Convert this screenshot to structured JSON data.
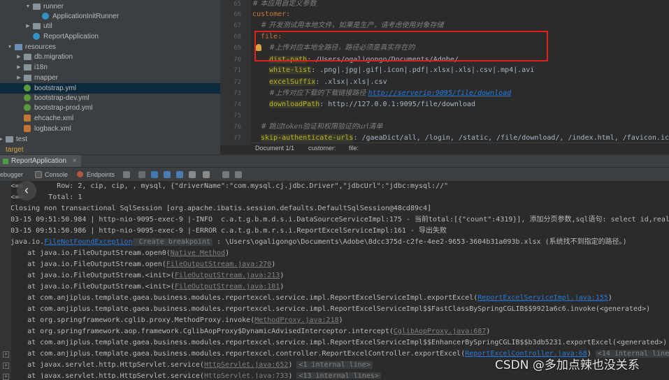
{
  "project_tree": [
    {
      "label": "runner",
      "kind": "folder",
      "expanded": true,
      "indent": 2
    },
    {
      "label": "ApplicationInitRunner",
      "kind": "class",
      "indent": 3
    },
    {
      "label": "util",
      "kind": "folder",
      "expanded": false,
      "indent": 2
    },
    {
      "label": "ReportApplication",
      "kind": "class",
      "indent": 2
    },
    {
      "label": "resources",
      "kind": "folder",
      "expanded": true,
      "indent": 0
    },
    {
      "label": "db.migration",
      "kind": "folder",
      "expanded": false,
      "indent": 1
    },
    {
      "label": "i18n",
      "kind": "folder",
      "expanded": false,
      "indent": 1
    },
    {
      "label": "mapper",
      "kind": "folder",
      "expanded": false,
      "indent": 1
    },
    {
      "label": "bootstrap.yml",
      "kind": "yml",
      "indent": 1,
      "selected": true
    },
    {
      "label": "bootstrap-dev.yml",
      "kind": "yml",
      "indent": 1
    },
    {
      "label": "bootstrap-prod.yml",
      "kind": "yml",
      "indent": 1
    },
    {
      "label": "ehcache.xml",
      "kind": "xml",
      "indent": 1
    },
    {
      "label": "logback.xml",
      "kind": "xml",
      "indent": 1
    },
    {
      "label": "test",
      "kind": "folder",
      "expanded": false,
      "indent": -1
    },
    {
      "label": "target",
      "kind": "folder-orange",
      "expanded": false,
      "indent": -1
    }
  ],
  "editor": {
    "line_numbers": [
      "65",
      "66",
      "67",
      "68",
      "69",
      "70",
      "71",
      "72",
      "73",
      "74",
      "75",
      "76",
      "77"
    ],
    "lines": [
      {
        "segments": [
          {
            "t": "# 本应用自定义参数",
            "c": "c-com"
          }
        ],
        "indent": 0
      },
      {
        "segments": [
          {
            "t": "customer:",
            "c": "c-key"
          }
        ],
        "indent": 0
      },
      {
        "segments": [
          {
            "t": "# 开发测试用本地文件，如果是生产，请考虑使用对象存储",
            "c": "c-com"
          }
        ],
        "indent": 2
      },
      {
        "segments": [
          {
            "t": "file:",
            "c": "c-key"
          }
        ],
        "indent": 2
      },
      {
        "segments": [
          {
            "t": "#上传对应本地全路径，路径必须是真实存在的",
            "c": "c-com"
          }
        ],
        "indent": 4
      },
      {
        "segments": [
          {
            "t": "dist-path",
            "c": "c-keyhl"
          },
          {
            "t": ": /Users/ogaligongo/Documents/Adobe/",
            "c": "c-val"
          }
        ],
        "indent": 4
      },
      {
        "segments": [
          {
            "t": "white-list",
            "c": "c-keyhl"
          },
          {
            "t": ": .png|.jpg|.gif|.icon|.pdf|.xlsx|.xls|.csv|.mp4|.avi",
            "c": "c-val"
          }
        ],
        "indent": 4
      },
      {
        "segments": [
          {
            "t": "excelSuffix",
            "c": "c-keyhl"
          },
          {
            "t": ": .xlsx|.xls|.csv",
            "c": "c-val"
          }
        ],
        "indent": 4
      },
      {
        "segments": [
          {
            "t": "#上传对应下载的下载链接路径 ",
            "c": "c-com"
          },
          {
            "t": "http://serverip:9095/file/download",
            "c": "c-url"
          }
        ],
        "indent": 4
      },
      {
        "segments": [
          {
            "t": "downloadPath",
            "c": "c-keyhl"
          },
          {
            "t": ": http://127.0.0.1:9095/file/download",
            "c": "c-val"
          }
        ],
        "indent": 4
      },
      {
        "segments": [
          {
            "t": "",
            "c": "c-val"
          }
        ],
        "indent": 0
      },
      {
        "segments": [
          {
            "t": "# 跳过token验证和权限验证的url清单",
            "c": "c-com"
          }
        ],
        "indent": 2
      },
      {
        "segments": [
          {
            "t": "skip-authenticate-urls",
            "c": "c-keyhl"
          },
          {
            "t": ": /gaeaDict/all, /login, /static, /file/download/, /index.html, /favicon.ico,",
            "c": "c-val"
          }
        ],
        "indent": 2
      }
    ],
    "breadcrumb": [
      "Document 1/1",
      "customer:",
      "file:"
    ]
  },
  "target_label": "target",
  "run_tab": {
    "label": "ReportApplication"
  },
  "toolbar": {
    "debugger_label": "ebugger",
    "console_label": "Console",
    "endpoints_label": "Endpoints"
  },
  "console": {
    "lines": [
      {
        "html_parts": [
          {
            "t": "<==        Row: 2, cip, cip, , mysql, {\"driverName\":\"com.mysql.cj.jdbc.Driver\",\"jdbcUrl\":\"jdbc:mysql://\""
          }
        ]
      },
      {
        "html_parts": [
          {
            "t": "<==      Total: 1"
          }
        ]
      },
      {
        "html_parts": [
          {
            "t": "Closing non transactional SqlSession [org.apache.ibatis.session.defaults.DefaultSqlSession@48cd89c4]"
          }
        ]
      },
      {
        "html_parts": [
          {
            "t": "03-15 09:51:50.984 | http-nio-9095-exec-9 |-INFO  c.a.t.g.b.m.d.s.i.DataSourceServiceImpl:175 - 当前total:[{\"count\":4319}], 添加分页参数,sql语句: select id,real_name"
          }
        ]
      },
      {
        "html_parts": [
          {
            "t": "03-15 09:51:50.986 | http-nio-9095-exec-9 |-ERROR c.a.t.g.b.m.r.s.i.ReportExcelServiceImpl:161 - 导出失败"
          }
        ]
      },
      {
        "html_parts": [
          {
            "t": "java.io."
          },
          {
            "t": "FileNotFoundException",
            "c": "lnk"
          },
          {
            "t": " Create breakpoint",
            "c": "badge"
          },
          {
            "t": " : \\Users\\ogaligongo\\Documents\\Adobe\\8dcc375d-c2fe-4ee2-9653-3604b31a093b.xlsx (系统找不到指定的路径。)"
          }
        ]
      },
      {
        "html_parts": [
          {
            "t": "    at java.io.FileOutputStream.open0("
          },
          {
            "t": "Native Method",
            "c": "lnk gr"
          },
          {
            "t": ")"
          }
        ]
      },
      {
        "html_parts": [
          {
            "t": "    at java.io.FileOutputStream.open("
          },
          {
            "t": "FileOutputStream.java:270",
            "c": "lnk gr"
          },
          {
            "t": ")"
          }
        ]
      },
      {
        "html_parts": [
          {
            "t": "    at java.io.FileOutputStream.<init>("
          },
          {
            "t": "FileOutputStream.java:213",
            "c": "lnk gr"
          },
          {
            "t": ")"
          }
        ]
      },
      {
        "html_parts": [
          {
            "t": "    at java.io.FileOutputStream.<init>("
          },
          {
            "t": "FileOutputStream.java:101",
            "c": "lnk gr"
          },
          {
            "t": ")"
          }
        ]
      },
      {
        "html_parts": [
          {
            "t": "    at com.anjiplus.template.gaea.business.modules.reportexcel.service.impl.ReportExcelServiceImpl.exportExcel("
          },
          {
            "t": "ReportExcelServiceImpl.java:155",
            "c": "exlink"
          },
          {
            "t": ")"
          }
        ]
      },
      {
        "html_parts": [
          {
            "t": "    at com.anjiplus.template.gaea.business.modules.reportexcel.service.impl.ReportExcelServiceImpl$$FastClassBySpringCGLIB$$9921a6c6.invoke(<generated>)"
          }
        ]
      },
      {
        "html_parts": [
          {
            "t": "    at org.springframework.cglib.proxy.MethodProxy.invoke("
          },
          {
            "t": "MethodProxy.java:218",
            "c": "lnk gr"
          },
          {
            "t": ")"
          }
        ]
      },
      {
        "html_parts": [
          {
            "t": "    at org.springframework.aop.framework.CglibAopProxy$DynamicAdvisedInterceptor.intercept("
          },
          {
            "t": "CglibAopProxy.java:687",
            "c": "lnk gr"
          },
          {
            "t": ")"
          }
        ]
      },
      {
        "html_parts": [
          {
            "t": "    at com.anjiplus.template.gaea.business.modules.reportexcel.service.impl.ReportExcelServiceImpl$$EnhancerBySpringCGLIB$$b3db5231.exportExcel(<generated>)"
          }
        ]
      },
      {
        "html_parts": [
          {
            "t": "    at com.anjiplus.template.gaea.business.modules.reportexcel.controller.ReportExcelController.exportExcel("
          },
          {
            "t": "ReportExcelController.java:68",
            "c": "exlink"
          },
          {
            "t": ") "
          },
          {
            "t": "<14 internal lines>",
            "c": "badge"
          }
        ]
      },
      {
        "html_parts": [
          {
            "t": "    at javax.servlet.http.HttpServlet.service("
          },
          {
            "t": "HttpServlet.java:652",
            "c": "lnk gr"
          },
          {
            "t": ") "
          },
          {
            "t": "<1 internal line>",
            "c": "badge"
          }
        ]
      },
      {
        "html_parts": [
          {
            "t": "    at javax.servlet.http.HttpServlet.service("
          },
          {
            "t": "HttpServlet.java:733",
            "c": "lnk gr"
          },
          {
            "t": ") "
          },
          {
            "t": "<13 internal lines>",
            "c": "badge"
          }
        ]
      }
    ],
    "fold_rows": [
      15,
      16,
      17
    ]
  },
  "watermark": "CSDN @多加点辣也没关系",
  "colors": {
    "highlight_box": "#e0221c",
    "keyword": "#cc7832",
    "comment": "#808080",
    "link": "#287bde"
  }
}
